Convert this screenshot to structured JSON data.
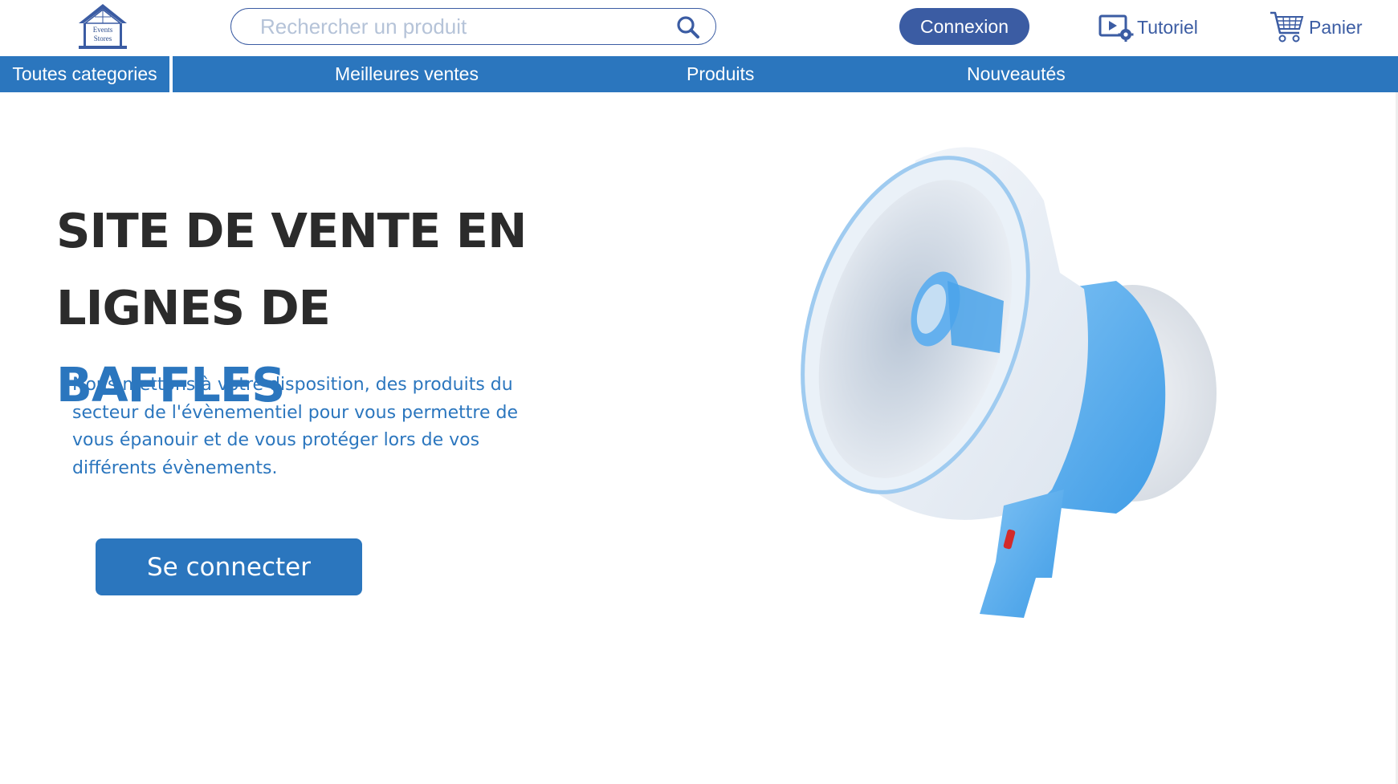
{
  "header": {
    "logo": {
      "line1": "Events",
      "line2": "Stores",
      "icon": "store-house-logo"
    },
    "search": {
      "placeholder": "Rechercher un produit",
      "value": "",
      "icon": "search-icon"
    },
    "login_label": "Connexion",
    "tutorial": {
      "label": "Tutoriel",
      "icon": "video-settings-icon"
    },
    "cart": {
      "label": "Panier",
      "icon": "shopping-cart-icon"
    }
  },
  "categories": {
    "all_label": "Toutes categories",
    "items": [
      {
        "label": "Meilleures ventes"
      },
      {
        "label": "Produits"
      },
      {
        "label": "Nouveautés"
      }
    ]
  },
  "hero": {
    "title_line1": "SITE DE VENTE EN",
    "title_line2_prefix": "LIGNES DE ",
    "title_line2_accent": "BAFFLES",
    "description": "Nous mettons à votre disposition, des produits du secteur de l'évènementiel pour vous permettre de vous épanouir et de vous protéger lors de vos différents évènements.",
    "cta_label": "Se connecter",
    "image": "megaphone-illustration"
  },
  "colors": {
    "primary": "#2b76be",
    "navy": "#3b5ca3",
    "heading": "#2b2b2b",
    "background": "#ffffff"
  }
}
